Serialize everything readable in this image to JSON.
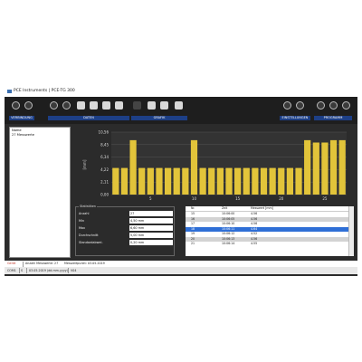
{
  "window": {
    "title": "PCE Instruments | PCE-TG 300"
  },
  "toolbar": {
    "groups": [
      "VERBINDUNG",
      "DATEN",
      "GRAFIK",
      "EINSTELLUNGEN",
      "PROGRAMM"
    ]
  },
  "sidebar": {
    "header": "Name",
    "items": [
      "27 Messwerte"
    ]
  },
  "stats": {
    "legend": "Statistiken",
    "rows": [
      {
        "label": "Anzahl",
        "value": "27"
      },
      {
        "label": "Min",
        "value": "4,50 mm"
      },
      {
        "label": "Max",
        "value": "6,60 mm"
      },
      {
        "label": "Durchschnitt",
        "value": "5,00 mm"
      },
      {
        "label": "Standardabwei.",
        "value": "0,20 mm"
      }
    ]
  },
  "table": {
    "headers": [
      "Nr.",
      "Zeit",
      "Messwert [mm]"
    ],
    "rows": [
      [
        "15",
        "10:06:00",
        "4.56"
      ],
      [
        "16",
        "10:06:05",
        "4.56"
      ],
      [
        "17",
        "10:06:10",
        "4.56"
      ],
      [
        "18",
        "10:06:11",
        "4.64"
      ],
      [
        "19",
        "10:06:12",
        "4.52"
      ],
      [
        "20",
        "10:06:13",
        "4.56"
      ],
      [
        "21",
        "10:06:14",
        "4.55"
      ]
    ],
    "selected_row": 3
  },
  "status": {
    "left": "Gerät",
    "count": "Anzahl Messwerte: 27",
    "date_label": "Messzeitpunkt: 03.05.2019",
    "port": "COM1",
    "mode": "S",
    "datetime": "03.05.2019 (dd.mm.yyyy)",
    "fw": "V04"
  },
  "chart_data": {
    "type": "bar",
    "ylabel": "[mm]",
    "ylim": [
      0,
      10.56
    ],
    "yticks": [
      "10,56",
      "8,45",
      "6,34",
      "4,22",
      "2,11",
      "0,00"
    ],
    "xticks": [
      "5",
      "10",
      "15",
      "20",
      "25"
    ],
    "categories": [
      1,
      2,
      3,
      4,
      5,
      6,
      7,
      8,
      9,
      10,
      11,
      12,
      13,
      14,
      15,
      16,
      17,
      18,
      19,
      20,
      21,
      22,
      23,
      24,
      25,
      26,
      27
    ],
    "values": [
      4.5,
      4.5,
      9.2,
      4.5,
      4.5,
      4.5,
      4.5,
      4.5,
      4.5,
      9.2,
      4.5,
      4.5,
      4.5,
      4.5,
      4.5,
      4.5,
      4.5,
      4.5,
      4.5,
      4.5,
      4.5,
      4.5,
      9.2,
      8.8,
      8.8,
      9.2,
      9.2
    ],
    "bar_color": "#e2c43a",
    "grid": true
  }
}
